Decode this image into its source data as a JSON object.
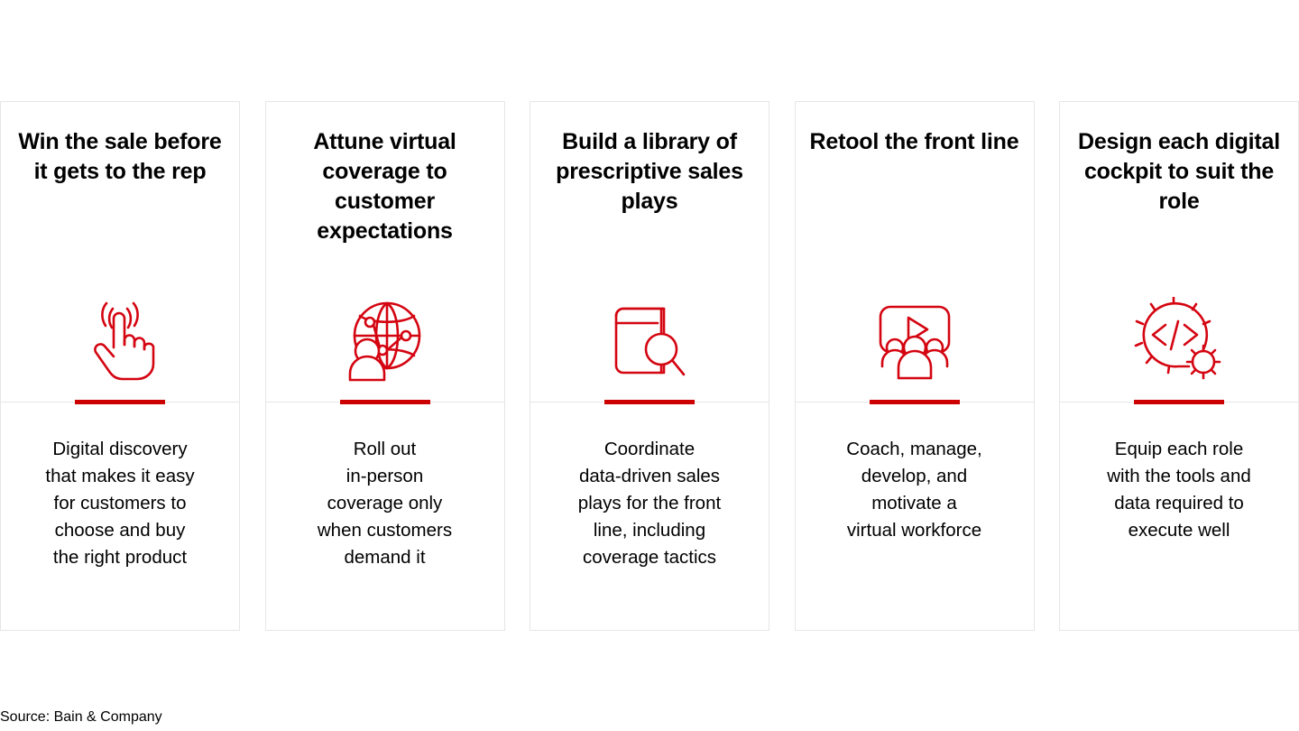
{
  "accent_color": "#cc0000",
  "border_color": "#e6e6e6",
  "background_color": "#ffffff",
  "cards": [
    {
      "title": "Win the sale\nbefore it gets\nto the rep",
      "icon": "tap-gesture-icon",
      "text": "Digital discovery\nthat makes it easy\nfor customers to\nchoose and buy\nthe right product"
    },
    {
      "title": "Attune virtual\ncoverage to\ncustomer\nexpectations",
      "icon": "globe-network-person-icon",
      "text": "Roll out\nin-person\ncoverage only\nwhen customers\ndemand it"
    },
    {
      "title": "Build a library\nof prescriptive\nsales plays",
      "icon": "book-magnifier-icon",
      "text": "Coordinate\ndata-driven sales\nplays for the front\nline, including\ncoverage tactics"
    },
    {
      "title": "Retool the\nfront line",
      "icon": "video-training-group-icon",
      "text": "Coach, manage,\ndevelop, and\nmotivate a\nvirtual workforce"
    },
    {
      "title": "Design each\ndigital cockpit\nto suit the role",
      "icon": "code-gear-circle-icon",
      "text": "Equip each role\nwith the tools and\ndata required to\nexecute well"
    }
  ],
  "source": "Source: Bain & Company"
}
